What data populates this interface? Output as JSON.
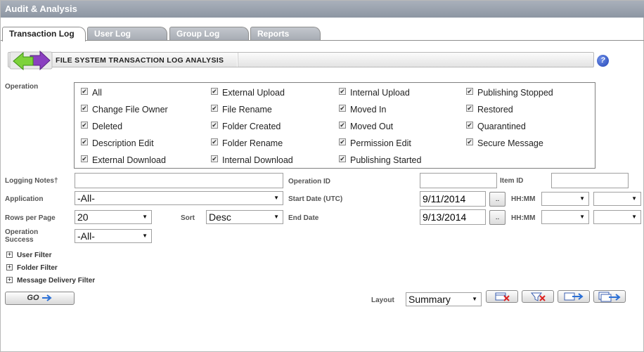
{
  "window": {
    "title": "Audit & Analysis"
  },
  "tabs": [
    {
      "label": "Transaction Log"
    },
    {
      "label": "User Log"
    },
    {
      "label": "Group Log"
    },
    {
      "label": "Reports"
    }
  ],
  "banner": {
    "title": "FILE SYSTEM TRANSACTION LOG ANALYSIS",
    "help_label": "?"
  },
  "operation": {
    "label": "Operation",
    "options": [
      {
        "label": "All",
        "checked": true
      },
      {
        "label": "External Upload",
        "checked": true
      },
      {
        "label": "Internal Upload",
        "checked": true
      },
      {
        "label": "Publishing Stopped",
        "checked": true
      },
      {
        "label": "Change File Owner",
        "checked": true
      },
      {
        "label": "File Rename",
        "checked": true
      },
      {
        "label": "Moved In",
        "checked": true
      },
      {
        "label": "Restored",
        "checked": true
      },
      {
        "label": "Deleted",
        "checked": true
      },
      {
        "label": "Folder Created",
        "checked": true
      },
      {
        "label": "Moved Out",
        "checked": true
      },
      {
        "label": "Quarantined",
        "checked": true
      },
      {
        "label": "Description Edit",
        "checked": true
      },
      {
        "label": "Folder Rename",
        "checked": true
      },
      {
        "label": "Permission Edit",
        "checked": true
      },
      {
        "label": "Secure Message",
        "checked": true
      },
      {
        "label": "External Download",
        "checked": true
      },
      {
        "label": "Internal Download",
        "checked": true
      },
      {
        "label": "Publishing Started",
        "checked": true
      }
    ]
  },
  "form": {
    "logging_notes_label": "Logging Notes†",
    "operation_id_label": "Operation ID",
    "item_id_label": "Item ID",
    "application_label": "Application",
    "application_value": "-All-",
    "start_date_label": "Start Date (UTC)",
    "start_date_value": "9/11/2014",
    "end_date_label": "End Date",
    "end_date_value": "9/13/2014",
    "hhmm_label": "HH:MM",
    "date_picker_label": "..",
    "rows_per_page_label": "Rows per Page",
    "rows_per_page_value": "20",
    "sort_label": "Sort",
    "sort_value": "Desc",
    "operation_success_label": "Operation Success",
    "operation_success_value": "-All-"
  },
  "filters": [
    {
      "label": "User Filter"
    },
    {
      "label": "Folder Filter"
    },
    {
      "label": "Message Delivery Filter"
    }
  ],
  "actions": {
    "go_label": "GO",
    "layout_label": "Layout",
    "layout_value": "Summary"
  }
}
